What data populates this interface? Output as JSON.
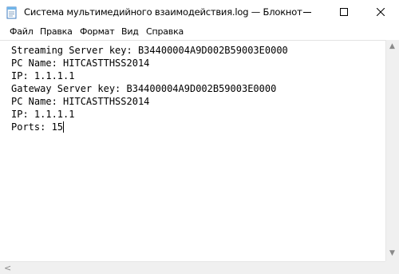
{
  "window": {
    "title": "Система мультимедийного взаимодействия.log — Блокнот",
    "controls": {
      "minimize": "minimize-icon",
      "maximize": "maximize-icon",
      "close": "close-icon"
    }
  },
  "menu": {
    "items": [
      {
        "label": "Файл"
      },
      {
        "label": "Правка"
      },
      {
        "label": "Формат"
      },
      {
        "label": "Вид"
      },
      {
        "label": "Справка"
      }
    ]
  },
  "editor": {
    "lines": [
      "Streaming Server key: B34400004A9D002B59003E0000",
      "PC Name: HITCASTTHSS2014",
      "IP: 1.1.1.1",
      "Gateway Server key: B34400004A9D002B59003E0000",
      "PC Name: HITCASTTHSS2014",
      "IP: 1.1.1.1",
      "Ports: 15"
    ]
  },
  "scrollbars": {
    "vertical": {
      "up": "▲",
      "down": "▼"
    },
    "horizontal": {
      "left": "<"
    }
  },
  "colors": {
    "title_bg": "#ffffff",
    "menu_bg": "#ffffff",
    "editor_bg": "#ffffff",
    "text": "#000000",
    "scrollbar": "#f0f0f0"
  }
}
